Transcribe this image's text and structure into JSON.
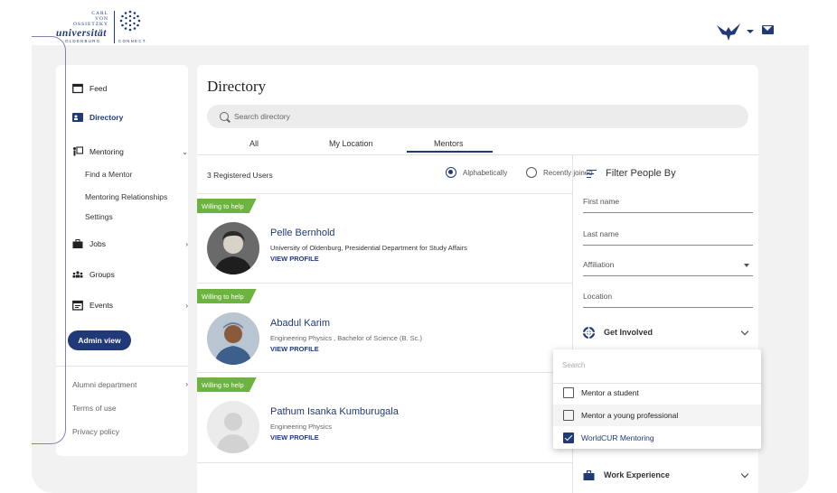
{
  "header": {
    "logo_small": [
      "CARL",
      "VON",
      "OSSIETZKY"
    ],
    "logo_main": "universität",
    "logo_sub_left": "OLDENBURG",
    "logo_sub_right": "CONNECT."
  },
  "sidebar": {
    "feed": "Feed",
    "directory": "Directory",
    "mentoring": "Mentoring",
    "mentoring_sub": [
      "Find a Mentor",
      "Mentoring Relationships",
      "Settings"
    ],
    "jobs": "Jobs",
    "groups": "Groups",
    "events": "Events",
    "admin": "Admin view",
    "alumni": "Alumni department",
    "terms": "Terms of use",
    "privacy": "Privacy policy"
  },
  "main": {
    "title": "Directory",
    "search_placeholder": "Search directory",
    "tabs": [
      "All",
      "My Location",
      "Mentors"
    ],
    "active_tab": "Mentors",
    "count": "3 Registered Users",
    "sort_options": [
      "Alphabetically",
      "Recently joined"
    ],
    "sort_selected": "Alphabetically"
  },
  "users": [
    {
      "badge": "Willing to help",
      "name": "Pelle Bernhold",
      "affiliation": "University of Oldenburg, Presidential Department for Study Affairs",
      "action": "VIEW PROFILE"
    },
    {
      "badge": "Willing to help",
      "name": "Abadul Karim",
      "affiliation": "Engineering Physics , Bachelor of Science (B. Sc.)",
      "action": "VIEW PROFILE"
    },
    {
      "badge": "Willing to help",
      "name": "Pathum Isanka Kumburugala",
      "affiliation": "Engineering Physics",
      "action": "VIEW PROFILE"
    }
  ],
  "filter": {
    "title": "Filter People By",
    "first_name": "First name",
    "last_name": "Last name",
    "affiliation": "Affiliation",
    "location": "Location",
    "get_involved": "Get Involved",
    "work_experience": "Work Experience"
  },
  "dropdown": {
    "search": "Search",
    "options": [
      {
        "label": "Mentor a student",
        "checked": false
      },
      {
        "label": "Mentor a young professional",
        "checked": false
      },
      {
        "label": "WorldCUR Mentoring",
        "checked": true
      }
    ]
  },
  "colors": {
    "brand": "#1f3a77",
    "badge": "#6db33f",
    "frame": "#8a7fb5"
  }
}
